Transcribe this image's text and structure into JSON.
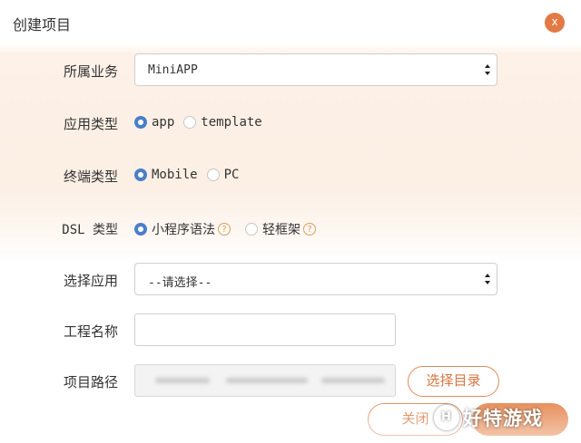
{
  "dialog": {
    "title": "创建项目",
    "close_label": "x"
  },
  "form": {
    "business": {
      "label": "所属业务",
      "value": "MiniAPP"
    },
    "app_type": {
      "label": "应用类型",
      "options": [
        {
          "label": "app",
          "selected": true
        },
        {
          "label": "template",
          "selected": false
        }
      ]
    },
    "terminal_type": {
      "label": "终端类型",
      "options": [
        {
          "label": "Mobile",
          "selected": true
        },
        {
          "label": "PC",
          "selected": false
        }
      ]
    },
    "dsl_type": {
      "label": "DSL 类型",
      "options": [
        {
          "label": "小程序语法",
          "selected": true,
          "help": "?"
        },
        {
          "label": "轻框架",
          "selected": false,
          "help": "?"
        }
      ]
    },
    "select_app": {
      "label": "选择应用",
      "value": "--请选择--"
    },
    "project_name": {
      "label": "工程名称",
      "value": ""
    },
    "project_path": {
      "label": "项目路径",
      "browse_label": "选择目录"
    }
  },
  "footer": {
    "close_label": "关闭",
    "confirm_label": ""
  },
  "watermark": {
    "text": "好特游戏",
    "logo": "H"
  },
  "colors": {
    "accent": "#e5874f",
    "radio_selected": "#4a7fc7",
    "help_icon": "#d9a060"
  }
}
